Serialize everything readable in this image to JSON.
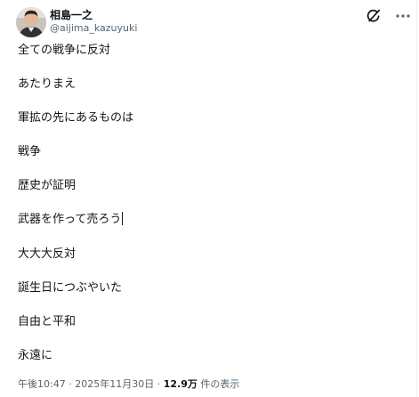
{
  "author": {
    "display_name": "相島一之",
    "handle": "@aijima_kazuyuki"
  },
  "icons": {
    "avatar": "profile-photo",
    "grok": "grok-icon",
    "more": "more-horizontal-icon"
  },
  "post": {
    "lines": [
      "全ての戦争に反対",
      "あたりまえ",
      "軍拡の先にあるものは",
      "戦争",
      "歴史が証明",
      "武器を作って売ろう",
      "大大大反対",
      "誕生日につぶやいた",
      "自由と平和",
      "永遠に"
    ]
  },
  "meta": {
    "time": "午後10:47",
    "separator": "·",
    "date": "2025年11月30日",
    "views_count": "12.9万",
    "views_label": "件の表示"
  },
  "colors": {
    "text": "#0f1419",
    "secondary": "#536471",
    "border": "#eff3f4"
  }
}
